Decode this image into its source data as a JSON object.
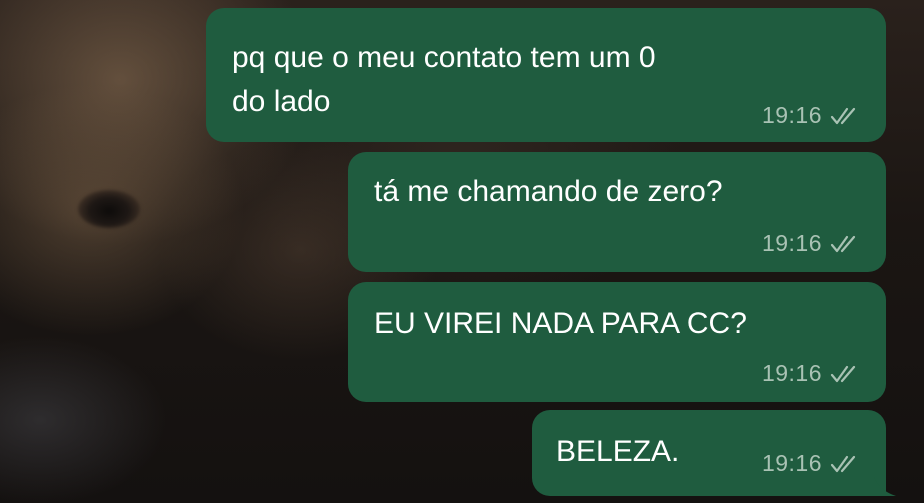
{
  "messages": [
    {
      "text_line1": "pq que o meu contato tem um 0",
      "text_line2": "do lado",
      "time": "19:16",
      "status_icon": "double-check-icon"
    },
    {
      "text": "tá me chamando de zero?",
      "time": "19:16",
      "status_icon": "double-check-icon"
    },
    {
      "text": "EU VIREI NADA PARA CC?",
      "time": "19:16",
      "status_icon": "double-check-icon"
    },
    {
      "text": "BELEZA.",
      "time": "19:16",
      "status_icon": "double-check-icon"
    }
  ],
  "colors": {
    "bubble": "#1f5c3f",
    "text": "#ffffff",
    "meta": "#a9c2b4"
  }
}
